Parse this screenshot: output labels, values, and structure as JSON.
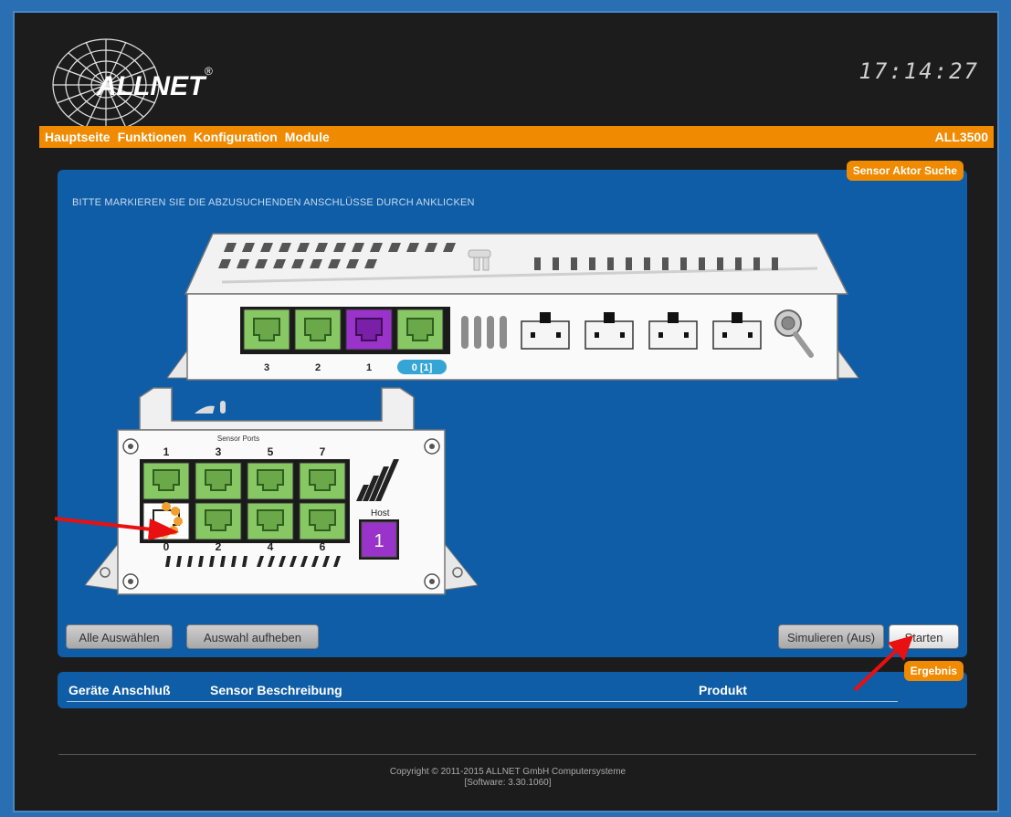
{
  "header": {
    "brand": "ALLNET",
    "registered": "®",
    "clock": "17:14:27"
  },
  "menu": {
    "items": [
      "Hauptseite",
      "Funktionen",
      "Konfiguration",
      "Module"
    ],
    "model": "ALL3500"
  },
  "sensor_search": {
    "tag": "Sensor Aktor Suche",
    "instruction": "Bitte markieren Sie die abzusuchenden Anschlüsse durch anklicken",
    "top_device": {
      "ports": [
        "3",
        "2",
        "1",
        "0 [1]"
      ],
      "port_colors": [
        "#88c864",
        "#88c864",
        "#9a33c9",
        "#88c864"
      ],
      "sfp_count": 4
    },
    "bottom_device": {
      "header": "Sensor Ports",
      "top_labels": [
        "1",
        "3",
        "5",
        "7"
      ],
      "bottom_labels": [
        "0",
        "2",
        "4",
        "6"
      ],
      "host_label": "Host",
      "host_port": "1"
    },
    "buttons": {
      "select_all": "Alle Auswählen",
      "deselect": "Auswahl aufheben",
      "simulate": "Simulieren (Aus)",
      "start": "Starten"
    }
  },
  "result": {
    "tag": "Ergebnis",
    "columns": [
      "Geräte Anschluß",
      "Sensor Beschreibung",
      "Produkt"
    ]
  },
  "footer": {
    "copyright": "Copyright © 2011-2015 ALLNET GmbH Computersysteme",
    "software": "[Software: 3.30.1060]"
  },
  "colors": {
    "accent": "#f08a00",
    "panel": "#0e5da6",
    "port_green": "#88c864",
    "port_purple": "#9a33c9",
    "arrow": "#e81010"
  }
}
